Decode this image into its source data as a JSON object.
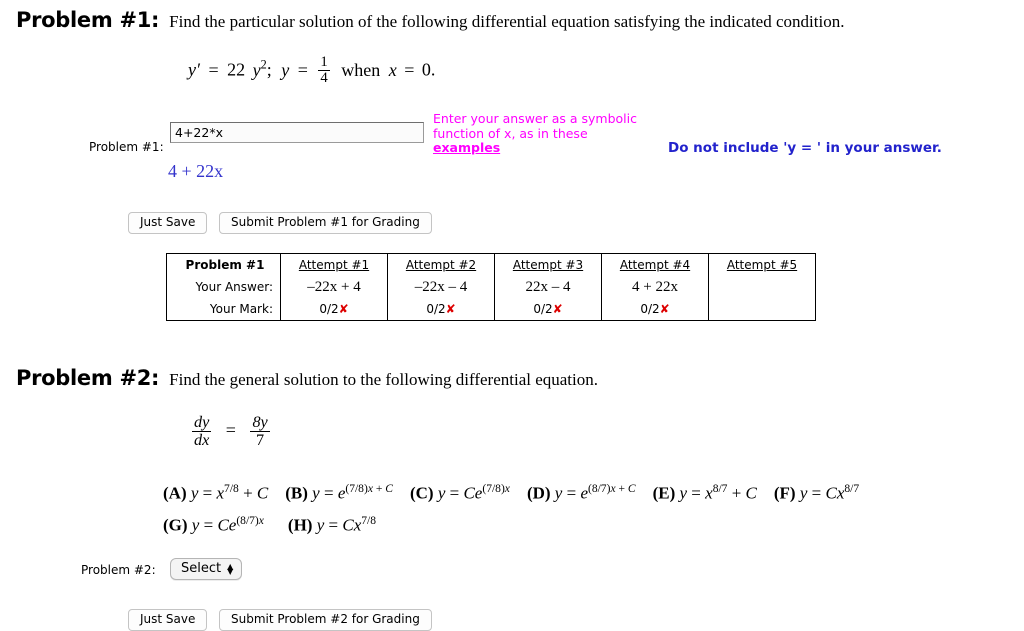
{
  "problem1": {
    "heading_label": "Problem #1:",
    "heading_text": "Find the particular solution of the following differential equation satisfying the indicated condition.",
    "equation": {
      "lhs": "y′",
      "eq": "=",
      "coefficient": "22",
      "variable": "y",
      "exponent": "2",
      "separator": ";",
      "condition_var": "y",
      "condition_eq": "=",
      "frac_num": "1",
      "frac_den": "4",
      "when_text": "when",
      "when_var": "x",
      "when_eq": "=",
      "when_val": "0."
    },
    "answer_row_label": "Problem #1:",
    "answer_value": "4+22*x",
    "answer_placeholder": "",
    "hint_pink_line1": "Enter your answer as a symbolic",
    "hint_pink_line2": "function of x, as in these",
    "hint_pink_link": "examples",
    "hint_blue": "Do not include 'y = ' in your answer.",
    "preview": "4 + 22x",
    "buttons": {
      "just_save": "Just Save",
      "submit": "Submit Problem #1 for Grading"
    },
    "table": {
      "row_labels": [
        "Problem #1",
        "Your Answer:",
        "Your Mark:"
      ],
      "attempt_headers": [
        "Attempt #1",
        "Attempt #2",
        "Attempt #3",
        "Attempt #4",
        "Attempt #5"
      ],
      "answers": [
        "–22x + 4",
        "–22x – 4",
        "22x – 4",
        "4 + 22x",
        ""
      ],
      "marks": [
        "0/2",
        "0/2",
        "0/2",
        "0/2",
        ""
      ],
      "mark_icons": [
        "✘",
        "✘",
        "✘",
        "✘",
        ""
      ]
    }
  },
  "problem2": {
    "heading_label": "Problem #2:",
    "heading_text": "Find the general solution to the following differential equation.",
    "equation": {
      "lhs_num": "dy",
      "lhs_den": "dx",
      "eq": "=",
      "rhs_num": "8y",
      "rhs_den": "7"
    },
    "choices_row1": [
      {
        "letter": "(A)",
        "text": "y = x^{7/8} + C"
      },
      {
        "letter": "(B)",
        "text": "y = e^{(7/8)x + C}"
      },
      {
        "letter": "(C)",
        "text": "y = Ce^{(7/8)x}"
      },
      {
        "letter": "(D)",
        "text": "y = e^{(8/7)x + C}"
      },
      {
        "letter": "(E)",
        "text": "y = x^{8/7} + C"
      },
      {
        "letter": "(F)",
        "text": "y = Cx^{8/7}"
      }
    ],
    "choices_row2": [
      {
        "letter": "(G)",
        "text": "y = Ce^{(8/7)x}"
      },
      {
        "letter": "(H)",
        "text": "y = Cx^{7/8}"
      }
    ],
    "answer_row_label": "Problem #2:",
    "select_label": "Select",
    "select_arrows": "▲▼",
    "buttons": {
      "just_save": "Just Save",
      "submit": "Submit Problem #2 for Grading"
    }
  },
  "colors": {
    "pink": "#ff00ff",
    "blue": "#2222cc",
    "preview_blue": "#3333cc",
    "red_x": "#dd0000"
  }
}
